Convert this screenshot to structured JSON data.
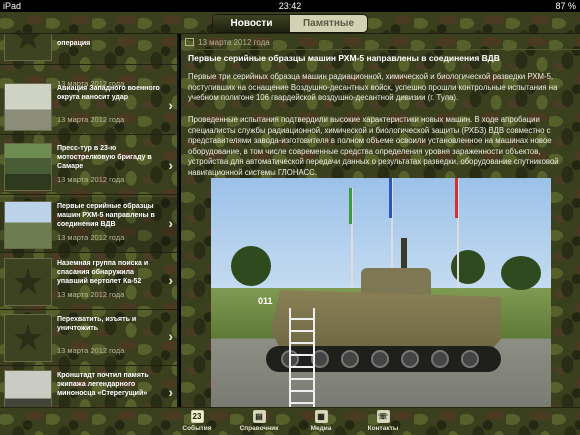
{
  "status_bar": {
    "carrier": "iPad",
    "wifi_icon": "wifi-icon",
    "time": "23:42",
    "battery": "87 %"
  },
  "segmented_control": {
    "tabs": [
      "Новости",
      "Памятные даты"
    ],
    "active_index": 0
  },
  "news_list": [
    {
      "title": "операция",
      "date": "13 марта 2012 года",
      "thumb": "star"
    },
    {
      "title": "Авиация Западного военного округа наносит удар",
      "date": "13 марта 2012 года",
      "thumb": "photo1"
    },
    {
      "title": "Пресс-тур в 23-ю мотострелковую бригаду в Самаре",
      "date": "13 марта 2012 года",
      "thumb": "photo2"
    },
    {
      "title": "Первые серийные образцы машин РХМ-5 направлены в соединения ВДВ",
      "date": "13 марта 2012 года",
      "thumb": "photo3"
    },
    {
      "title": "Наземная группа поиска и спасания обнаружила упавший вертолет Ка-52",
      "date": "13 марта 2012 года",
      "thumb": "star"
    },
    {
      "title": "Перехватить, изъять и уничтожить",
      "date": "13 марта 2012 года",
      "thumb": "star"
    },
    {
      "title": "Кронштадт почтил память экипажа легендарного миноносца «Стерегущий»",
      "date": "",
      "thumb": "photo4"
    }
  ],
  "article": {
    "date": "13 марта 2012 года",
    "title": "Первые серийные образцы машин РХМ-5 направлены в соединения ВДВ",
    "paragraph_1": "Первые три серийных образца машин радиационной, химической и биологической разведки РХМ-5, поступивших на оснащение Воздушно-десантных войск, успешно прошли контрольные испытания на учебном полигоне 106 гвардейской воздушно-десантной дивизии (г. Тула).",
    "paragraph_2": "Проведенные испытания подтвердили высокие характеристики новых машин. В ходе апробации специалисты службы радиационной, химической и биологической защиты (РХБЗ) ВДВ совместно с представителями завода-изготовителя в полном объеме освоили установленное на машинах новое оборудование, в том числе современные средства определения уровня зараженности объектов, устройства для автоматической передачи данных о результатах разведки, оборудование спутниковой навигационной системы ГЛОНАСС.",
    "photo_number": "011"
  },
  "tab_bar": [
    {
      "label": "События",
      "icon": "calendar-icon",
      "glyph": "23"
    },
    {
      "label": "Справочник",
      "icon": "book-icon",
      "glyph": "▤"
    },
    {
      "label": "Медиа",
      "icon": "film-icon",
      "glyph": "▦"
    },
    {
      "label": "Контакты",
      "icon": "phone-icon",
      "glyph": "☏"
    }
  ]
}
